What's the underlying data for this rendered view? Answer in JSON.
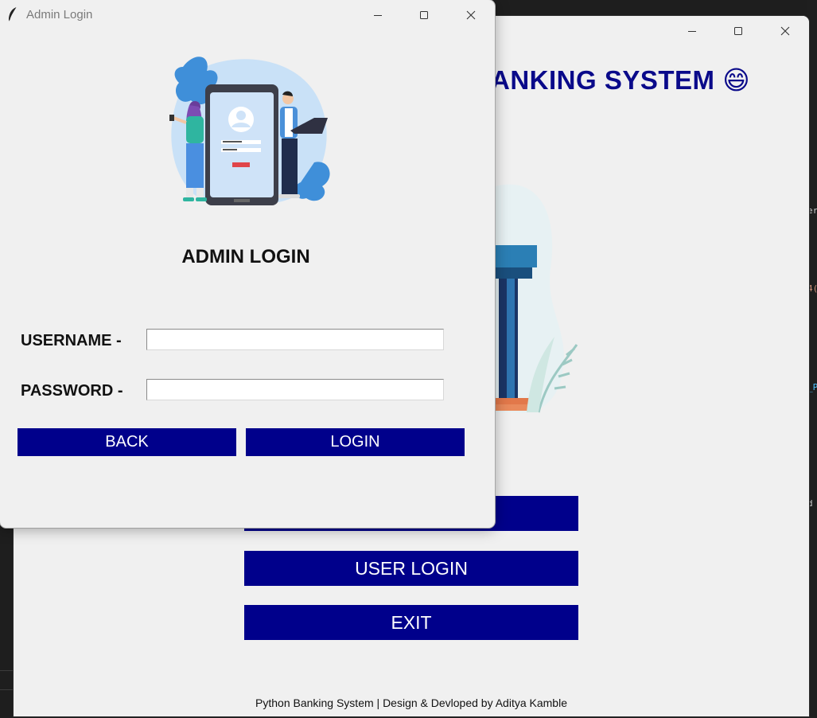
{
  "main_window": {
    "title_text": "ANKING SYSTEM 😄",
    "buttons": {
      "user_login": "USER LOGIN",
      "exit": "EXIT"
    },
    "footer": "Python Banking System | Design & Devloped by Aditya Kamble"
  },
  "dialog": {
    "window_title": "Admin Login",
    "heading": "ADMIN LOGIN",
    "username_label": "USERNAME -",
    "password_label": "PASSWORD -",
    "username_value": "",
    "password_value": "",
    "back_label": "BACK",
    "login_label": "LOGIN"
  },
  "colors": {
    "button_bg": "#00008b",
    "title_color": "#0a0a8a",
    "window_bg": "#f0f0f0"
  }
}
